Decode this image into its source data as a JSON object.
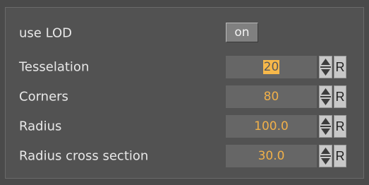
{
  "rows": [
    {
      "label": "use LOD",
      "toggle": "on"
    },
    {
      "label": "Tesselation",
      "value": "20",
      "reset": "R"
    },
    {
      "label": "Corners",
      "value": "80",
      "reset": "R"
    },
    {
      "label": "Radius",
      "value": "100.0",
      "reset": "R"
    },
    {
      "label": "Radius cross section",
      "value": "30.0",
      "reset": "R"
    }
  ],
  "colors": {
    "background": "#4a4a4a",
    "panel": "#525252",
    "value_text": "#f0b04a",
    "selection": "#f7b84a"
  }
}
